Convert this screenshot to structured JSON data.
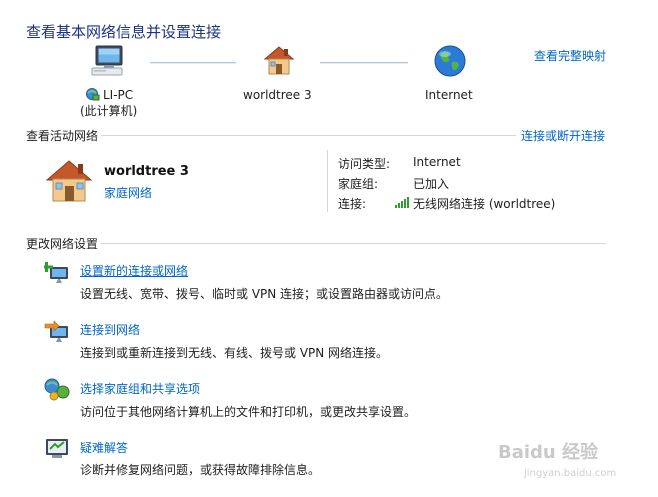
{
  "title": "查看基本网络信息并设置连接",
  "full_map_link": "查看完整映射",
  "map": {
    "computer_name": "LI-PC",
    "computer_sub": "(此计算机)",
    "network_name": "worldtree  3",
    "internet_label": "Internet"
  },
  "active_section": {
    "title": "查看活动网络",
    "connect_link": "连接或断开连接",
    "network_name": "worldtree  3",
    "network_type": "家庭网络",
    "access_type_key": "访问类型:",
    "access_type_val": "Internet",
    "homegroup_key": "家庭组:",
    "homegroup_val": "已加入",
    "connections_key": "连接:",
    "connections_val": "无线网络连接 (worldtree)"
  },
  "change_section": {
    "title": "更改网络设置",
    "tasks": [
      {
        "label": "设置新的连接或网络",
        "desc": "设置无线、宽带、拨号、临时或 VPN 连接；或设置路由器或访问点。",
        "icon": "new-connection-icon"
      },
      {
        "label": "连接到网络",
        "desc": "连接到或重新连接到无线、有线、拨号或 VPN 网络连接。",
        "icon": "connect-network-icon"
      },
      {
        "label": "选择家庭组和共享选项",
        "desc": "访问位于其他网络计算机上的文件和打印机，或更改共享设置。",
        "icon": "homegroup-icon"
      },
      {
        "label": "疑难解答",
        "desc": "诊断并修复网络问题，或获得故障排除信息。",
        "icon": "troubleshoot-icon"
      }
    ]
  },
  "watermark": {
    "main": "Baidu 经验",
    "sub": "jingyan.baidu.com"
  },
  "colors": {
    "title": "#1e3287",
    "link": "#0066cc",
    "line": "#d3d9e0"
  }
}
